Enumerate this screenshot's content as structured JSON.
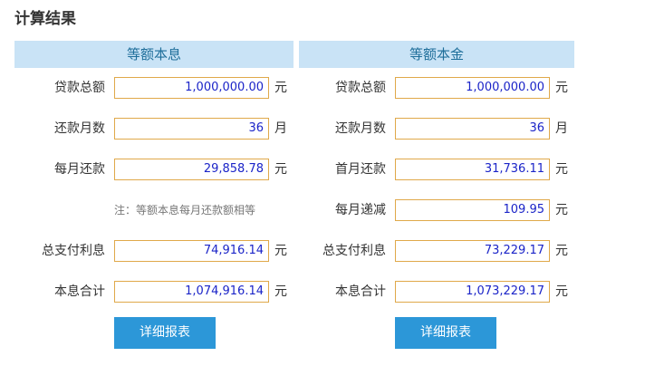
{
  "page": {
    "title": "计算结果"
  },
  "left": {
    "header": "等额本息",
    "loan_amount": {
      "label": "贷款总额",
      "value": "1,000,000.00",
      "unit": "元"
    },
    "months": {
      "label": "还款月数",
      "value": "36",
      "unit": "月"
    },
    "monthly_payment": {
      "label": "每月还款",
      "value": "29,858.78",
      "unit": "元"
    },
    "note": "注：等额本息每月还款额相等",
    "total_interest": {
      "label": "总支付利息",
      "value": "74,916.14",
      "unit": "元"
    },
    "total": {
      "label": "本息合计",
      "value": "1,074,916.14",
      "unit": "元"
    },
    "button": "详细报表"
  },
  "right": {
    "header": "等额本金",
    "loan_amount": {
      "label": "贷款总额",
      "value": "1,000,000.00",
      "unit": "元"
    },
    "months": {
      "label": "还款月数",
      "value": "36",
      "unit": "月"
    },
    "first_payment": {
      "label": "首月还款",
      "value": "31,736.11",
      "unit": "元"
    },
    "monthly_decrease": {
      "label": "每月递减",
      "value": "109.95",
      "unit": "元"
    },
    "total_interest": {
      "label": "总支付利息",
      "value": "73,229.17",
      "unit": "元"
    },
    "total": {
      "label": "本息合计",
      "value": "1,073,229.17",
      "unit": "元"
    },
    "button": "详细报表"
  },
  "colors": {
    "header_bg": "#c9e3f6",
    "field_border": "#e0a94a",
    "value_text": "#1b24c8",
    "button_bg": "#2c97d8"
  }
}
